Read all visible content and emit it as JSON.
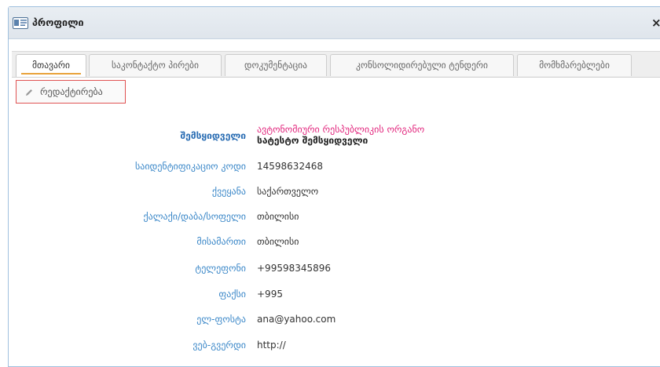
{
  "window": {
    "title": "პროფილი",
    "close_symbol": "×"
  },
  "icons": {
    "title": "profile-card-icon",
    "edit": "pencil-icon",
    "close": "close-icon"
  },
  "tabs": [
    {
      "label": "მთავარი",
      "active": true
    },
    {
      "label": "საკონტაქტო პირები",
      "active": false
    },
    {
      "label": "დოკუმენტაცია",
      "active": false
    },
    {
      "label": "კონსოლიდირებული ტენდერი",
      "active": false
    },
    {
      "label": "მომხმარებლები",
      "active": false
    }
  ],
  "edit_button": {
    "label": "რედაქტირება"
  },
  "fields": {
    "buyer": {
      "label": "შემსყიდველი",
      "value_line1": "ავტონომიური რესპუბლიკის ორგანო",
      "value_line2": "სატესტო შემსყიდველი"
    },
    "id_code": {
      "label": "საიდენტიფიკაციო კოდი",
      "value": "14598632468"
    },
    "country": {
      "label": "ქვეყანა",
      "value": "საქართველო"
    },
    "city": {
      "label": "ქალაქი/დაბა/სოფელი",
      "value": "თბილისი"
    },
    "address": {
      "label": "მისამართი",
      "value": "თბილისი"
    },
    "phone": {
      "label": "ტელეფონი",
      "value": "+99598345896"
    },
    "fax": {
      "label": "ფაქსი",
      "value": "+995"
    },
    "email": {
      "label": "ელ-ფოსტა",
      "value": "ana@yahoo.com"
    },
    "website": {
      "label": "ვებ-გვერდი",
      "value": "http://"
    }
  },
  "colors": {
    "label_blue": "#3a87c8",
    "accent_pink": "#e2267d",
    "edit_border_red": "#e05252",
    "tab_underline": "#e8a23a"
  }
}
